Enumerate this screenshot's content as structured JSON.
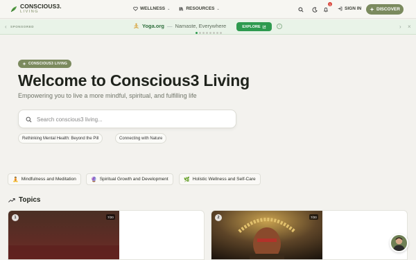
{
  "header": {
    "logo_main": "CONSCIOUS3.",
    "logo_sub": "LIVING",
    "nav": [
      {
        "label": "WELLNESS",
        "icon": "heart-icon"
      },
      {
        "label": "RESOURCES",
        "icon": "books-icon"
      }
    ],
    "notification_count": "1",
    "signin_label": "SIGN IN",
    "discover_label": "DISCOVER"
  },
  "sponsor": {
    "label": "SPONSORED",
    "brand": "Yoga.org",
    "dash": "—",
    "tagline": "Namaste, Everywhere",
    "cta": "EXPLORE",
    "info": "i",
    "slides": 8,
    "active_slide": 0
  },
  "hero": {
    "pill": "CONSCIOUS3 LIVING",
    "title": "Welcome to Conscious3 Living",
    "subtitle": "Empowering you to live a more mindful, spiritual, and fulfilling life",
    "search_placeholder": "Search conscious3 living...",
    "chips": [
      "Rethinking Mental Health: Beyond the Pill",
      "Connecting with Nature"
    ]
  },
  "categories": [
    {
      "emoji": "🧘",
      "label": "Mindfulness and Meditation"
    },
    {
      "emoji": "🔮",
      "label": "Spiritual Growth and Development"
    },
    {
      "emoji": "🌿",
      "label": "Holistic Wellness and Self-Care"
    }
  ],
  "topics": {
    "title": "Topics",
    "cards": [
      {
        "number": "1",
        "count": "7/20"
      },
      {
        "number": "2",
        "count": "7/20"
      }
    ]
  },
  "colors": {
    "accent": "#7b8a5e",
    "sponsor_bg": "#e9f3e8",
    "explore": "#2e9a4f"
  }
}
